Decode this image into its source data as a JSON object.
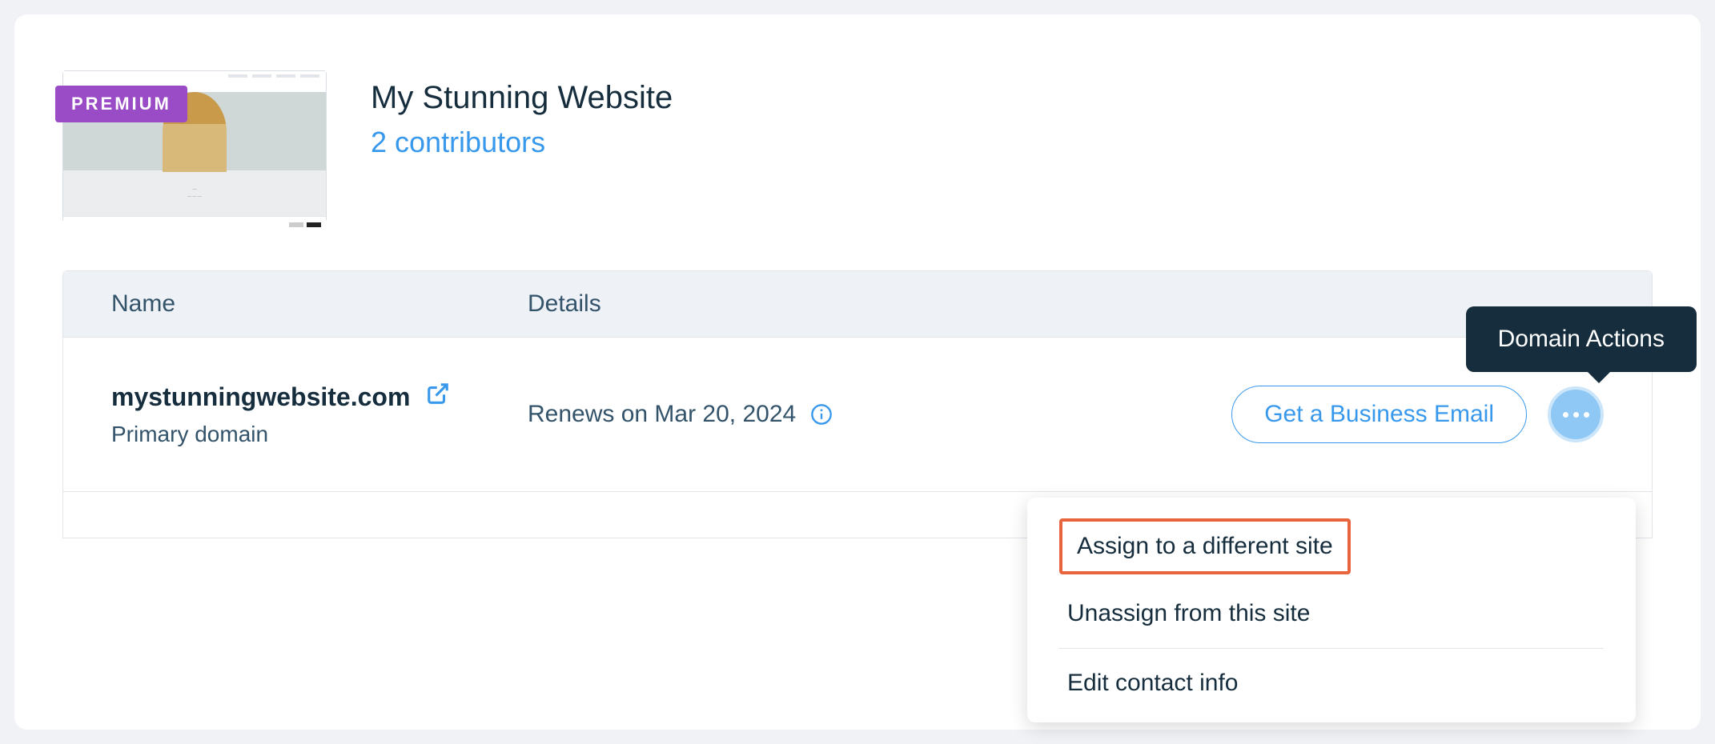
{
  "badge": "PREMIUM",
  "site": {
    "title": "My Stunning Website",
    "contributors_text": "2 contributors"
  },
  "table": {
    "headers": {
      "name": "Name",
      "details": "Details"
    },
    "row": {
      "domain": "mystunningwebsite.com",
      "subtitle": "Primary domain",
      "renew_text": "Renews on Mar 20, 2024",
      "cta": "Get a Business Email"
    }
  },
  "tooltip": "Domain Actions",
  "menu": {
    "assign": "Assign to a different site",
    "unassign": "Unassign from this site",
    "edit": "Edit contact info"
  }
}
